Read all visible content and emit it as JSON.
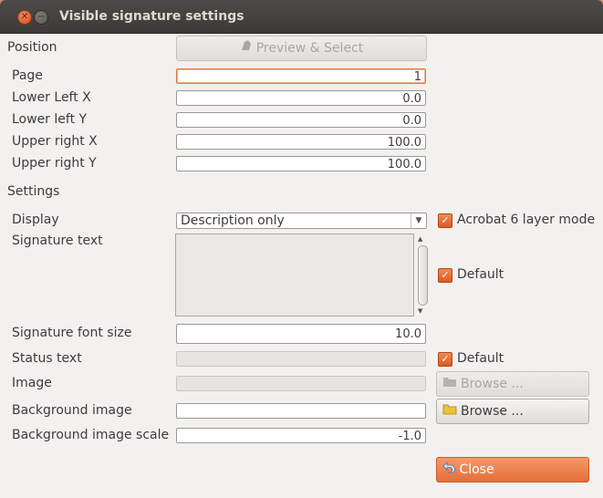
{
  "window": {
    "title": "Visible signature settings"
  },
  "position": {
    "header": "Position",
    "preview_button": "Preview & Select",
    "fields": {
      "page": {
        "label": "Page",
        "value": "1"
      },
      "lower_left_x": {
        "label": "Lower Left X",
        "value": "0.0"
      },
      "lower_left_y": {
        "label": "Lower left Y",
        "value": "0.0"
      },
      "upper_right_x": {
        "label": "Upper right X",
        "value": "100.0"
      },
      "upper_right_y": {
        "label": "Upper right Y",
        "value": "100.0"
      }
    }
  },
  "settings": {
    "header": "Settings",
    "display": {
      "label": "Display",
      "value": "Description only"
    },
    "acrobat_layer": {
      "label": "Acrobat 6 layer mode",
      "checked": true
    },
    "signature_text": {
      "label": "Signature text",
      "value": ""
    },
    "signature_default": {
      "label": "Default",
      "checked": true
    },
    "font_size": {
      "label": "Signature font size",
      "value": "10.0"
    },
    "status_text": {
      "label": "Status text",
      "value": ""
    },
    "status_default": {
      "label": "Default",
      "checked": true
    },
    "image": {
      "label": "Image",
      "browse": "Browse ..."
    },
    "background_image": {
      "label": "Background image",
      "browse": "Browse ..."
    },
    "background_scale": {
      "label": "Background image scale",
      "value": "-1.0"
    }
  },
  "close_button": "Close",
  "icons": {
    "close": "close-icon",
    "minimize": "minimize-icon",
    "preview": "signature-icon",
    "folder": "folder-icon",
    "close_action": "undo-arrow-icon"
  }
}
